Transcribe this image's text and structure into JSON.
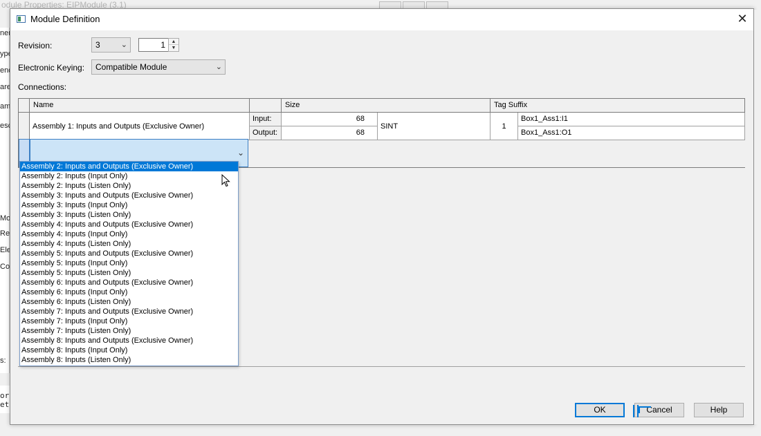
{
  "background_window": {
    "title": "odule Properties: EIPModule (3.1)",
    "side_labels": [
      "ner",
      "ype",
      "end",
      "are",
      "ame",
      "esc"
    ],
    "side_labels_lower": [
      "Mo",
      "Re",
      "Ele",
      "Co"
    ],
    "status_label": "s:",
    "bottom_text": [
      "or",
      "ete"
    ]
  },
  "dialog": {
    "title": "Module Definition",
    "close_glyph": "✕"
  },
  "revision": {
    "label": "Revision:",
    "major": "3",
    "minor": "1"
  },
  "keying": {
    "label": "Electronic Keying:",
    "value": "Compatible Module"
  },
  "connections": {
    "label": "Connections:",
    "headers": {
      "name": "Name",
      "size": "Size",
      "tag_suffix": "Tag Suffix"
    },
    "row1": {
      "name": "Assembly 1: Inputs and Outputs (Exclusive Owner)",
      "input_label": "Input:",
      "output_label": "Output:",
      "input_size": "68",
      "output_size": "68",
      "type": "SINT",
      "instance": "1",
      "input_tag": "Box1_Ass1:I1",
      "output_tag": "Box1_Ass1:O1"
    }
  },
  "dropdown": {
    "selected_index": 0,
    "items": [
      "Assembly 2: Inputs and Outputs (Exclusive Owner)",
      "Assembly 2: Inputs (Input Only)",
      "Assembly 2: Inputs (Listen Only)",
      "Assembly 3: Inputs and Outputs (Exclusive Owner)",
      "Assembly 3: Inputs (Input Only)",
      "Assembly 3: Inputs (Listen Only)",
      "Assembly 4: Inputs and Outputs (Exclusive Owner)",
      "Assembly 4: Inputs (Input Only)",
      "Assembly 4: Inputs (Listen Only)",
      "Assembly 5: Inputs and Outputs (Exclusive Owner)",
      "Assembly 5: Inputs (Input Only)",
      "Assembly 5: Inputs (Listen Only)",
      "Assembly 6: Inputs and Outputs (Exclusive Owner)",
      "Assembly 6: Inputs (Input Only)",
      "Assembly 6: Inputs (Listen Only)",
      "Assembly 7: Inputs and Outputs (Exclusive Owner)",
      "Assembly 7: Inputs (Input Only)",
      "Assembly 7: Inputs (Listen Only)",
      "Assembly 8: Inputs and Outputs (Exclusive Owner)",
      "Assembly 8: Inputs (Input Only)",
      "Assembly 8: Inputs (Listen Only)"
    ]
  },
  "buttons": {
    "ok": "OK",
    "cancel": "Cancel",
    "help": "Help"
  },
  "colors": {
    "selection": "#0078d7",
    "edit_cell": "#cce4f7"
  }
}
